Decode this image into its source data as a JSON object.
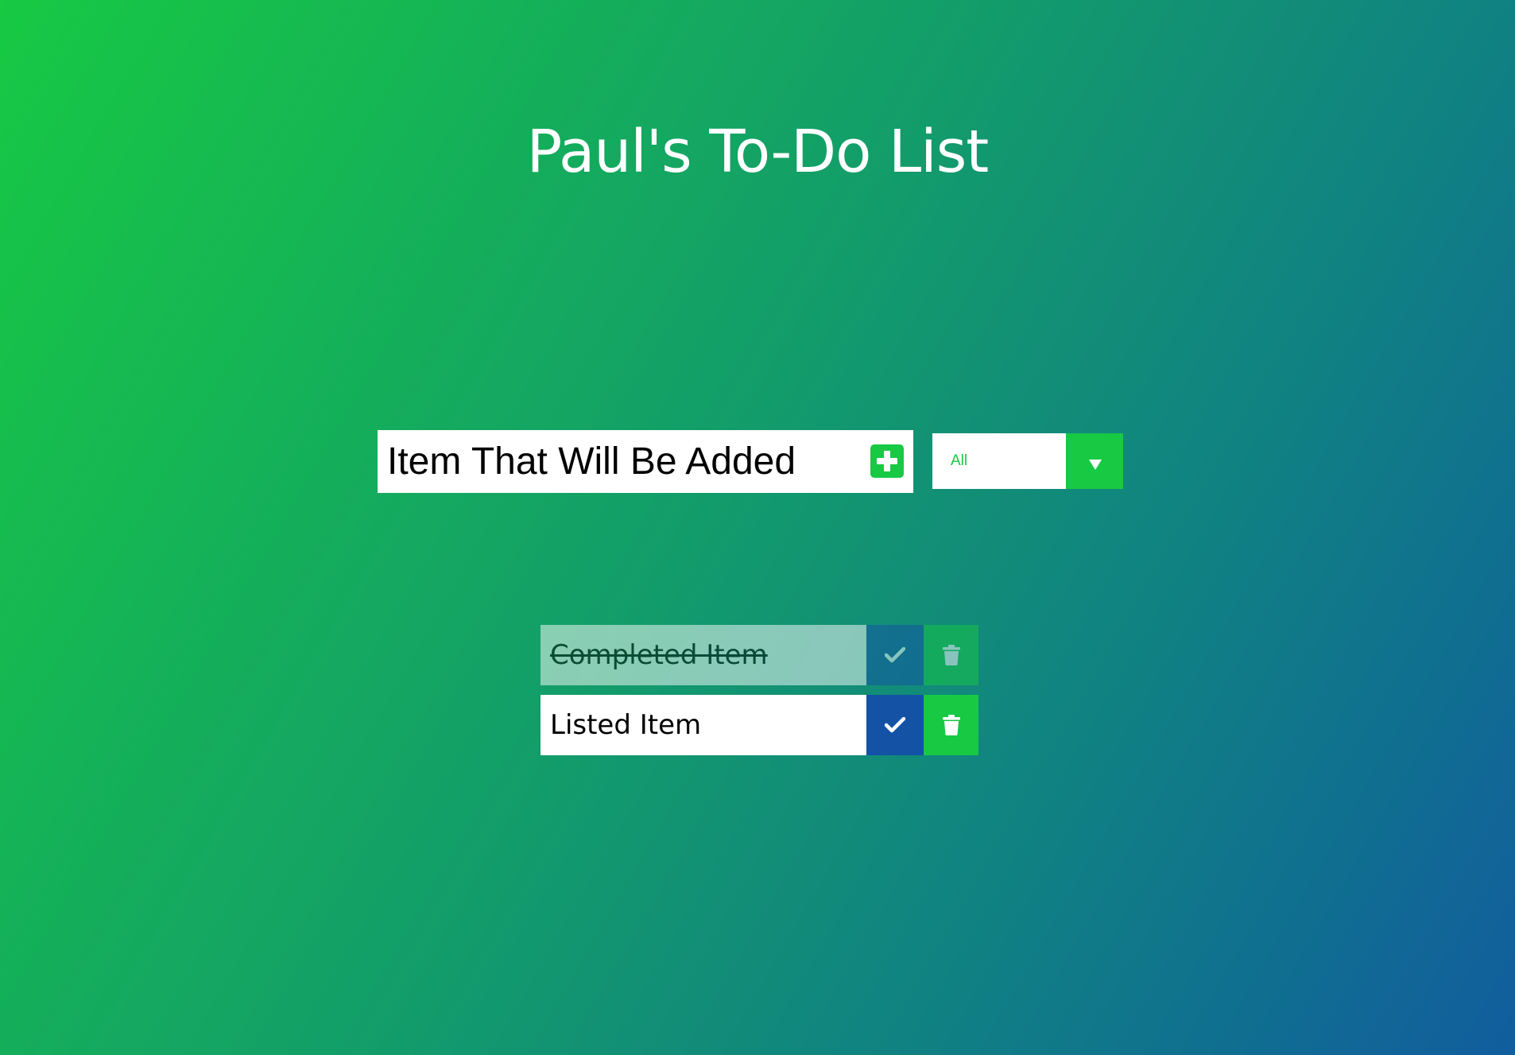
{
  "header": {
    "title": "Paul's To-Do List"
  },
  "add_form": {
    "input_value": "Item That Will Be Added",
    "add_icon": "plus-square-icon"
  },
  "filter": {
    "selected": "All",
    "arrow_icon": "triangle-down-icon"
  },
  "todos": [
    {
      "text": "Completed Item",
      "completed": true,
      "check_icon": "check-icon",
      "delete_icon": "trash-icon"
    },
    {
      "text": "Listed Item",
      "completed": false,
      "check_icon": "check-icon",
      "delete_icon": "trash-icon"
    }
  ],
  "colors": {
    "accent_green": "#17c943",
    "check_blue": "#1452a6",
    "gradient_start": "#17c943",
    "gradient_end": "#115d9e"
  }
}
